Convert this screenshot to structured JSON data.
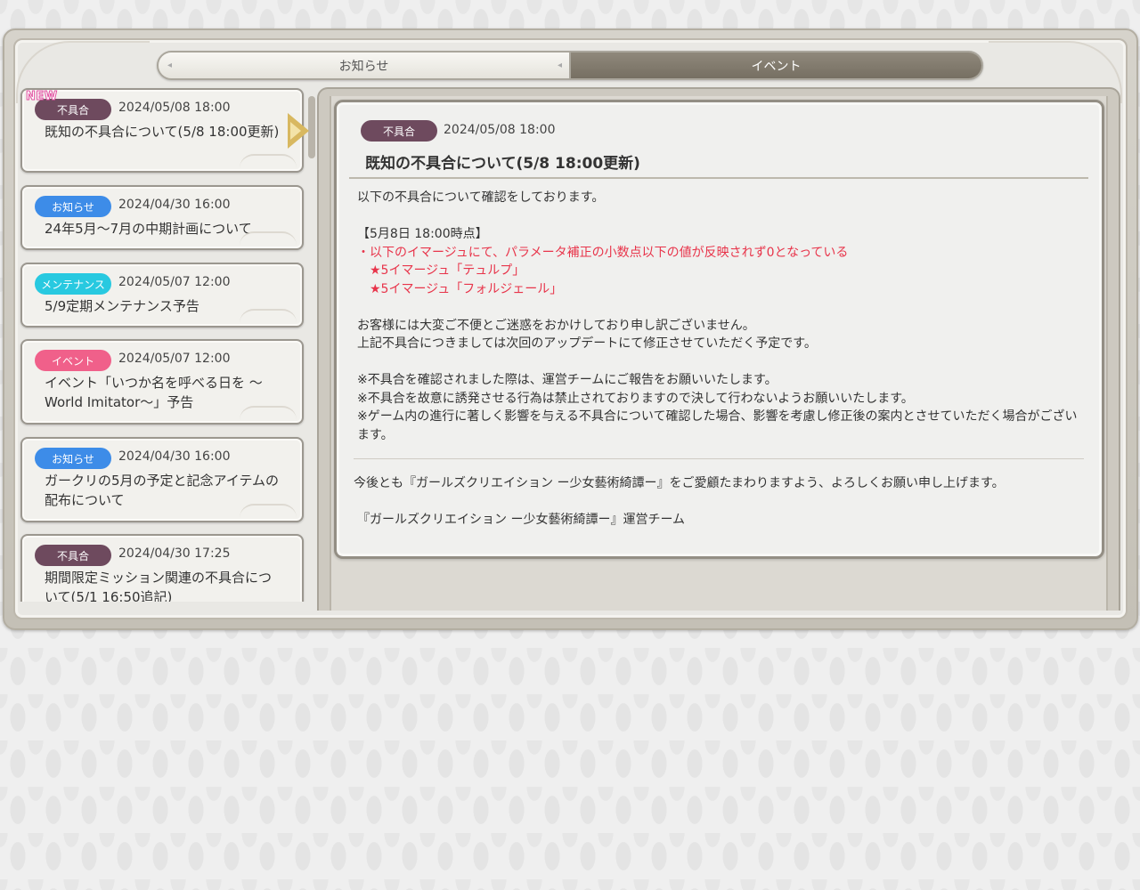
{
  "tabs": [
    {
      "label": "お知らせ",
      "active": false
    },
    {
      "label": "イベント",
      "active": true
    }
  ],
  "new_tag": "NEW",
  "list": [
    {
      "badge": "不具合",
      "badge_color": "#6e4a5e",
      "date": "2024/05/08 18:00",
      "title": "既知の不具合について(5/8 18:00更新)"
    },
    {
      "badge": "お知らせ",
      "badge_color": "#3d8ce8",
      "date": "2024/04/30 16:00",
      "title": "24年5月～7月の中期計画について"
    },
    {
      "badge": "メンテナンス",
      "badge_color": "#28c9e0",
      "date": "2024/05/07 12:00",
      "title": "5/9定期メンテナンス予告"
    },
    {
      "badge": "イベント",
      "badge_color": "#f0608a",
      "date": "2024/05/07 12:00",
      "title": "イベント「いつか名を呼べる日を ～World Imitator～」予告"
    },
    {
      "badge": "お知らせ",
      "badge_color": "#3d8ce8",
      "date": "2024/04/30 16:00",
      "title": "ガークリの5月の予定と記念アイテムの配布について"
    },
    {
      "badge": "不具合",
      "badge_color": "#6e4a5e",
      "date": "2024/04/30 17:25",
      "title": "期間限定ミッション関連の不具合について(5/1 16:50追記)"
    }
  ],
  "detail": {
    "badge": "不具合",
    "badge_color": "#6e4a5e",
    "date": "2024/05/08 18:00",
    "title": "既知の不具合について(5/8 18:00更新)",
    "intro": "以下の不具合について確認をしております。",
    "section_heading": "【5月8日 18:00時点】",
    "bug_line": "・以下のイマージュにて、パラメータ補正の小数点以下の値が反映されず0となっている",
    "bug_items": [
      "★5イマージュ「テュルプ」",
      "★5イマージュ「フォルジェール」"
    ],
    "apology_1": "お客様には大変ご不便とご迷惑をおかけしており申し訳ございません。",
    "apology_2": "上記不具合につきましては次回のアップデートにて修正させていただく予定です。",
    "note_1": "※不具合を確認されました際は、運営チームにご報告をお願いいたします。",
    "note_2": "※不具合を故意に誘発させる行為は禁止されておりますので決して行わないようお願いいたします。",
    "note_3": "※ゲーム内の進行に著しく影響を与える不具合について確認した場合、影響を考慮し修正後の案内とさせていただく場合がございます。",
    "closing": "今後とも『ガールズクリエイション ー少女藝術綺譚ー』をご愛顧たまわりますよう、よろしくお願い申し上げます。",
    "signature": "『ガールズクリエイション ー少女藝術綺譚ー』運営チーム"
  }
}
